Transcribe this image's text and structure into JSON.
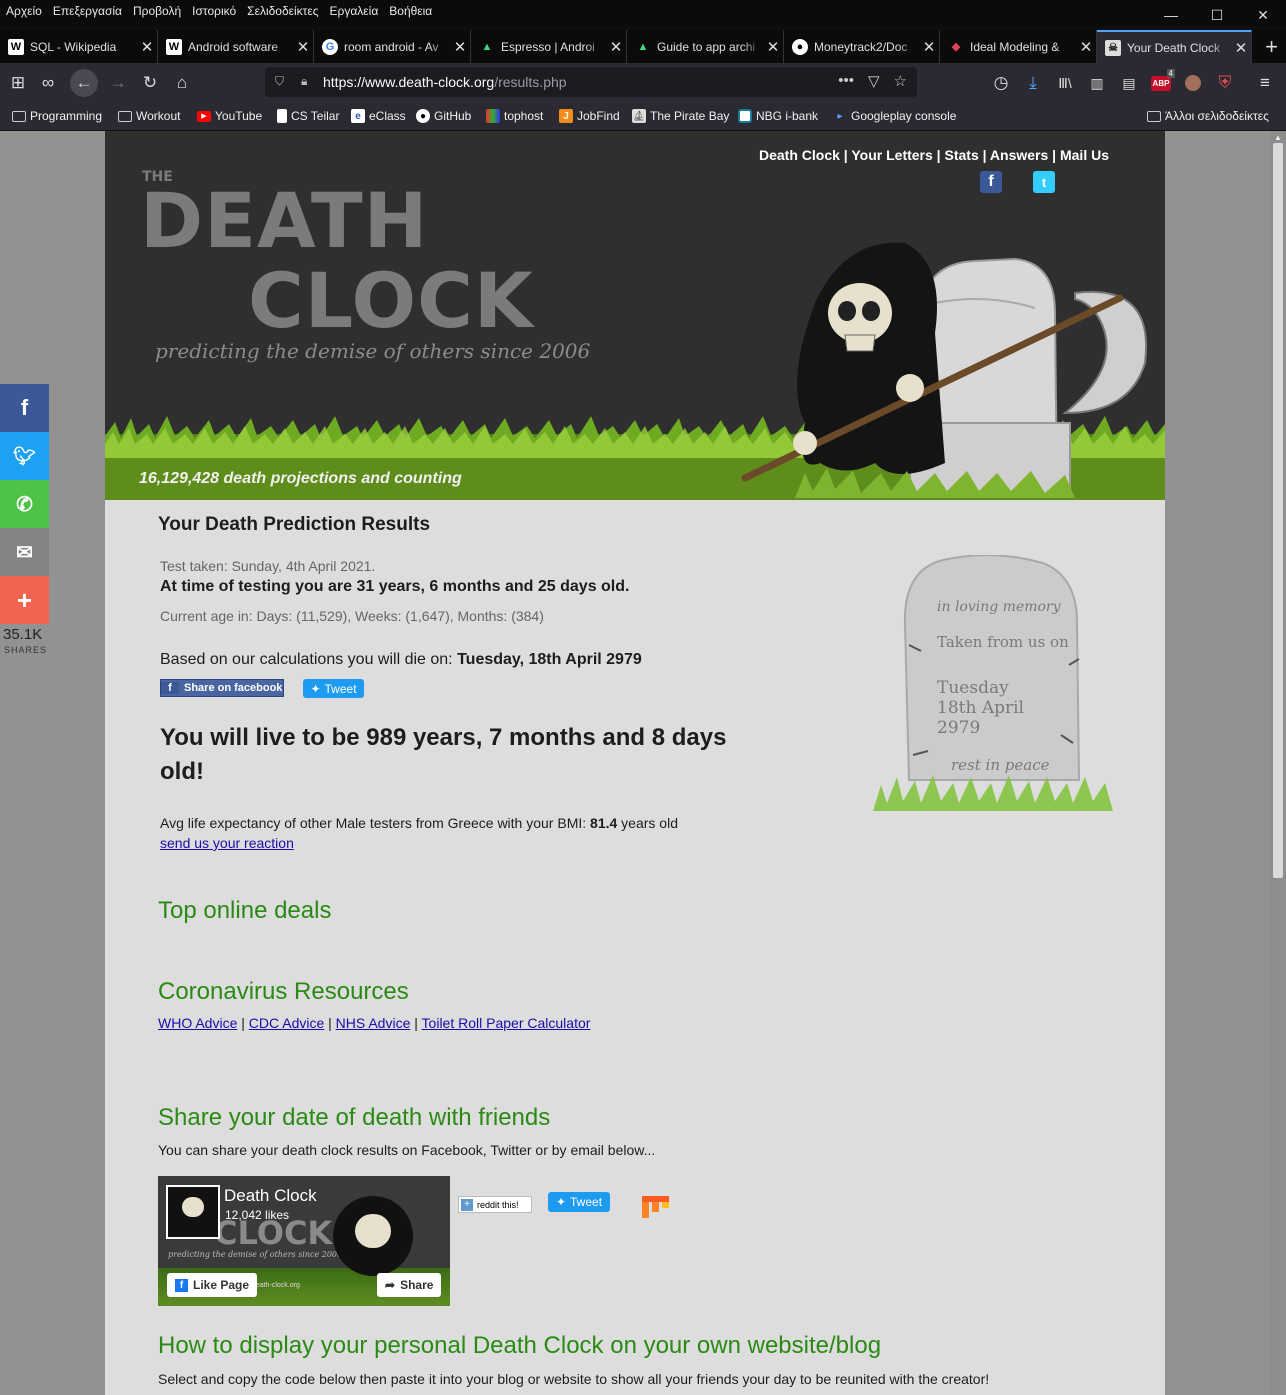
{
  "menubar": {
    "items": [
      "Αρχείο",
      "Επεξεργασία",
      "Προβολή",
      "Ιστορικό",
      "Σελιδοδείκτες",
      "Εργαλεία",
      "Βοήθεια"
    ]
  },
  "tabs": [
    {
      "title": "SQL - Wikipedia",
      "icon": "wikipedia-icon"
    },
    {
      "title": "Android software",
      "icon": "wikipedia-icon"
    },
    {
      "title": "room android - Av",
      "icon": "google-icon"
    },
    {
      "title": "Espresso | Androi",
      "icon": "android-icon"
    },
    {
      "title": "Guide to app archi",
      "icon": "android-icon"
    },
    {
      "title": "Moneytrack2/Doc",
      "icon": "github-icon"
    },
    {
      "title": "Ideal Modeling &",
      "icon": "diamond-icon"
    },
    {
      "title": "Your Death Clock",
      "icon": "death-clock-icon"
    }
  ],
  "urlbar": {
    "url_host": "https://www.death-clock.org",
    "url_path": "/results.php"
  },
  "toolbar": {
    "abp_badge": "ABP",
    "abp_count": "4"
  },
  "bookmarks": {
    "items": [
      "Programming",
      "Workout",
      "YouTube",
      "CS Teilar",
      "eClass",
      "GitHub",
      "tophost",
      "JobFind",
      "The Pirate Bay",
      "NBG i-bank",
      "Googleplay console"
    ],
    "other": "Άλλοι σελιδοδείκτες"
  },
  "header": {
    "links": [
      "Death Clock",
      "Your Letters",
      "Stats",
      "Answers",
      "Mail Us"
    ],
    "logo_the": "THE",
    "logo_death": "DEATH",
    "logo_clock": "CLOCK",
    "tagline": "predicting the demise of others since 2006",
    "count_text": "16,129,428 death projections and counting"
  },
  "results": {
    "title": "Your Death Prediction Results",
    "test_taken": "Test taken: Sunday, 4th April 2021.",
    "age_line": "At time of testing you are 31 years, 6 months and 25 days old.",
    "current_age": "Current age in: Days: (11,529), Weeks: (1,647), Months: (384)",
    "based_prefix": "Based on our calculations you will die on:",
    "death_date": "Tuesday, 18th April 2979",
    "fb_share": "Share on facebook",
    "tweet": "Tweet",
    "live_to": "You will live to be 989 years, 7 months and 8 days old!",
    "avg_prefix": "Avg life expectancy of other Male testers from Greece with your BMI:",
    "avg_value": "81.4",
    "avg_suffix": "years old",
    "reaction_link": "send us your reaction"
  },
  "tombstone": {
    "line1": "in loving memory",
    "line2": "Taken from us on",
    "line3": "Tuesday",
    "line4": "18th April",
    "line5": "2979",
    "line6": "rest in peace"
  },
  "sections": {
    "deals": "Top online deals",
    "corona": "Coronavirus Resources",
    "corona_links": [
      "WHO Advice",
      "CDC Advice",
      "NHS Advice",
      "Toilet Roll Paper Calculator"
    ],
    "share_heading": "Share your date of death with friends",
    "share_text": "You can share your death clock results on Facebook, Twitter or by email below...",
    "display_heading": "How to display your personal Death Clock on your own website/blog",
    "display_text": "Select and copy the code below then paste it into your blog or website to show all your friends your day to be reunited with the creator!"
  },
  "fb_widget": {
    "name": "Death Clock",
    "likes": "12,042 likes",
    "bg_logo": "CLOCK",
    "bg_tagline": "predicting the demise of others since 2006",
    "site": "death-clock.org",
    "like_btn": "Like Page",
    "share_btn": "Share"
  },
  "share_buttons": {
    "reddit": "reddit this!",
    "tweet": "Tweet"
  },
  "sidebar_share": {
    "count": "35.1K",
    "label": "SHARES"
  },
  "colors": {
    "header_bg": "#2f2f2f",
    "count_bar": "#5f8d1b",
    "heading_green": "#2a8a14",
    "link_blue": "#1a0dab",
    "facebook": "#3b5998",
    "twitter": "#1da1f2",
    "whatsapp": "#4dc247",
    "email": "#848484",
    "more": "#f26351"
  }
}
